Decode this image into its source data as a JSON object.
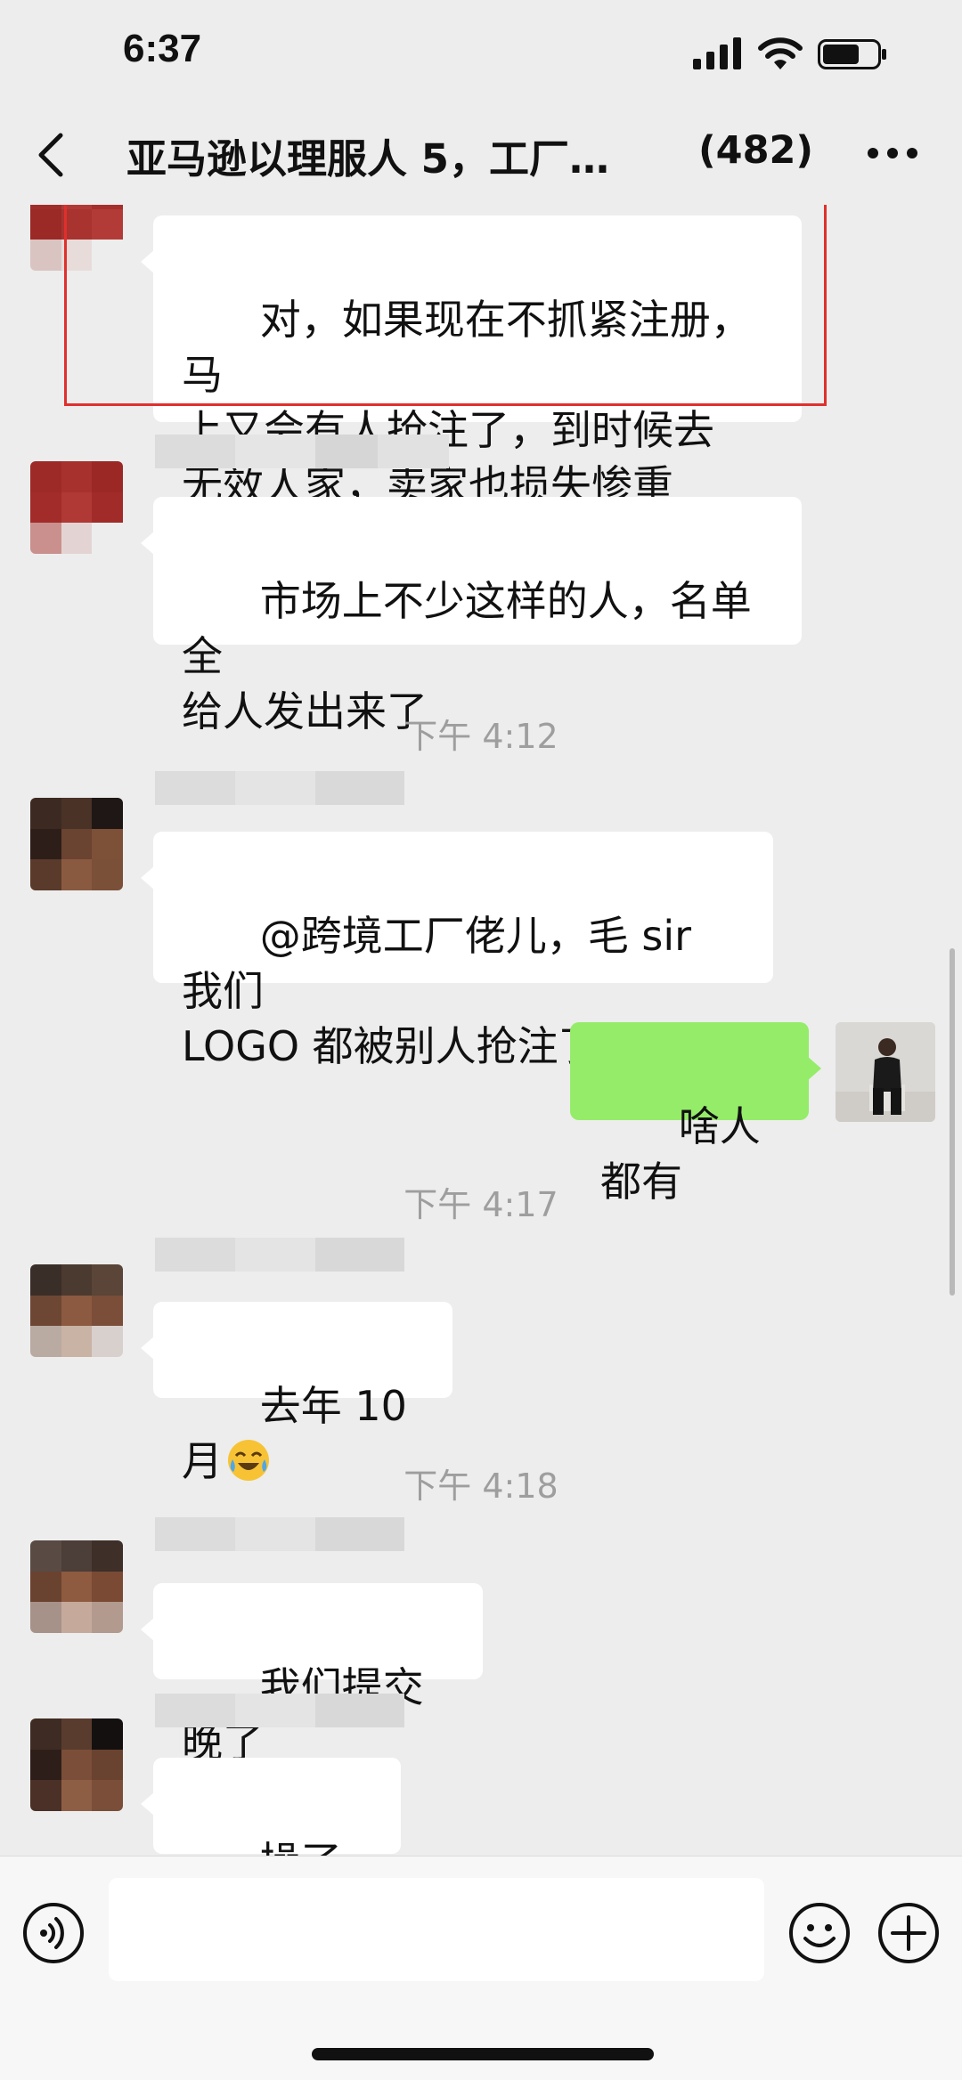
{
  "status_bar": {
    "time": "6:37"
  },
  "nav": {
    "title": "亚马逊以理服人 5，工厂…",
    "member_count": "(482)"
  },
  "messages": [
    {
      "sender": "other",
      "text": "对，如果现在不抓紧注册，马\n上又会有人抢注了，到时候去\n无效人家，卖家也损失惨重",
      "highlighted": true
    },
    {
      "sender": "other",
      "text": "市场上不少这样的人，名单全\n给人发出来了"
    },
    {
      "type": "time",
      "text": "下午 4:12"
    },
    {
      "sender": "other",
      "text": "@跨境工厂佬儿，毛 sir 我们\nLOGO 都被别人抢注了",
      "emoji": "crying-laughing-emoji"
    },
    {
      "sender": "self",
      "text": "啥人都有"
    },
    {
      "type": "time",
      "text": "下午 4:17"
    },
    {
      "sender": "other",
      "text": "去年 10月",
      "emoji": "crying-laughing-emoji"
    },
    {
      "type": "time",
      "text": "下午 4:18"
    },
    {
      "sender": "other",
      "text": "我们提交晚了"
    },
    {
      "sender": "other",
      "text": "操了个蛋"
    }
  ],
  "input": {
    "value": ""
  },
  "colors": {
    "background": "#EDEDED",
    "self_bubble": "#95EC69",
    "other_bubble": "#FFFFFF",
    "highlight_border": "#E0302D",
    "timestamp_text": "#9E9E9E"
  }
}
